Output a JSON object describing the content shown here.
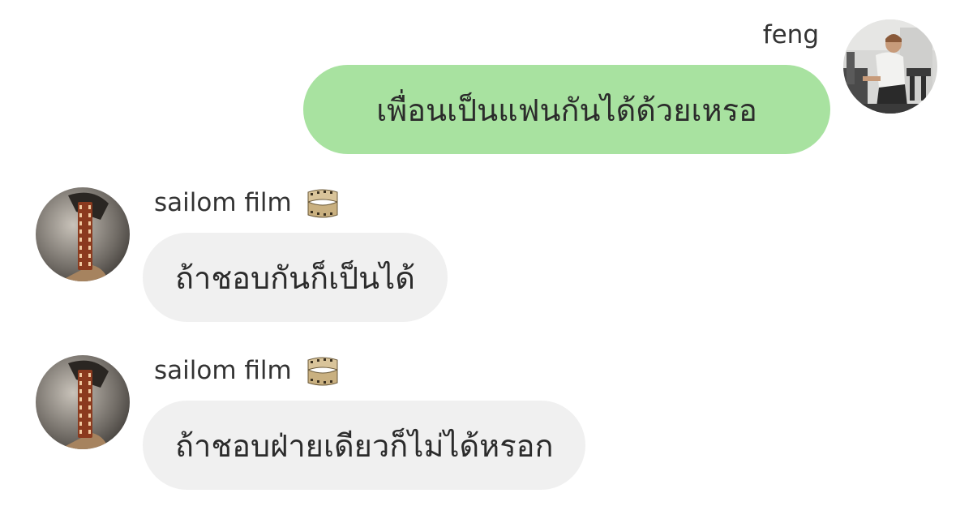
{
  "messages": [
    {
      "sender": "feng",
      "text": "เพื่อนเป็นแฟนกันได้ด้วยเหรอ",
      "side": "right"
    },
    {
      "sender": "sailom film",
      "sender_emoji": "film-strip-emoji",
      "text": "ถ้าชอบกันก็เป็นได้",
      "side": "left"
    },
    {
      "sender": "sailom film",
      "sender_emoji": "film-strip-emoji",
      "text": "ถ้าชอบฝ่ายเดียวก็ไม่ได้หรอก",
      "side": "left"
    }
  ],
  "colors": {
    "outgoing_bubble": "#a8e2a0",
    "incoming_bubble": "#f0f0f0",
    "text": "#2b2b2b"
  }
}
